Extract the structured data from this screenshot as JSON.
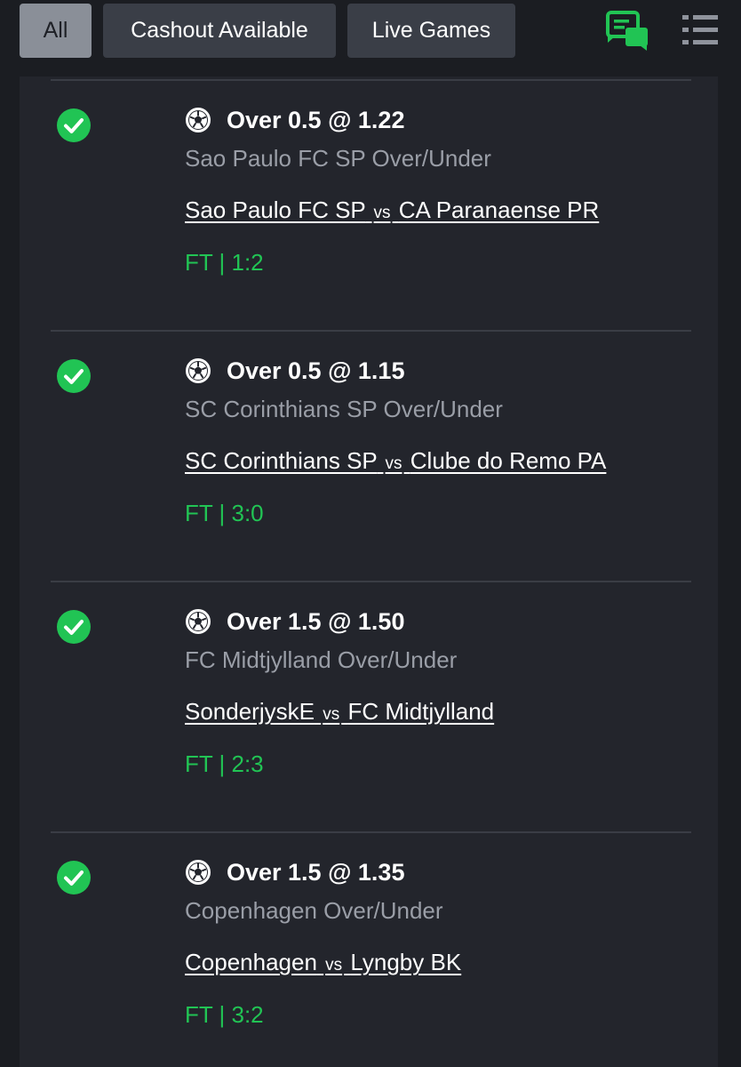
{
  "filters": {
    "all_label": "All",
    "cashout_label": "Cashout Available",
    "live_label": "Live Games"
  },
  "colors": {
    "accent_green": "#21c454",
    "background": "#1b1d22",
    "panel": "#23252c",
    "filter_active": "#8a8f98",
    "filter_inactive": "#3a3e47"
  },
  "icons": {
    "chat": "chat-icon",
    "menu": "list-menu-icon",
    "status": "check-circle-icon",
    "sport": "soccer-ball-icon"
  },
  "bets": [
    {
      "selection": "Over 0.5 @ 1.22",
      "market": "Sao Paulo FC SP Over/Under",
      "home": "Sao Paulo FC SP",
      "vs": "vs",
      "away": "CA Paranaense PR",
      "result": "FT | 1:2"
    },
    {
      "selection": "Over 0.5 @ 1.15",
      "market": "SC Corinthians SP Over/Under",
      "home": "SC Corinthians SP",
      "vs": "vs",
      "away": "Clube do Remo PA",
      "result": "FT | 3:0"
    },
    {
      "selection": "Over 1.5 @ 1.50",
      "market": "FC Midtjylland Over/Under",
      "home": "SonderjyskE",
      "vs": "vs",
      "away": "FC Midtjylland",
      "result": "FT | 2:3"
    },
    {
      "selection": "Over 1.5 @ 1.35",
      "market": "Copenhagen Over/Under",
      "home": "Copenhagen",
      "vs": "vs",
      "away": "Lyngby BK",
      "result": "FT | 3:2"
    }
  ]
}
